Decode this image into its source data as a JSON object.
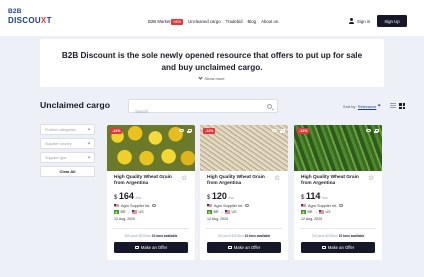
{
  "header": {
    "logo_top": "B2B",
    "logo_main": "DISCOU",
    "logo_x": "X",
    "logo_t": "T",
    "nav": [
      {
        "label": "B2B Market"
      },
      {
        "label": "Uncleaned cargo"
      },
      {
        "label": "Tradebid"
      },
      {
        "label": "Blog"
      },
      {
        "label": "About us"
      }
    ],
    "new_badge": "NEW",
    "signin_label": "Sign in",
    "signup_label": "Sign Up"
  },
  "hero": {
    "text": "B2B Discount is the sole newly opened resource that offers to put up for sale and buy unclaimed cargo.",
    "show_more": "Show more"
  },
  "toolbar": {
    "title": "Unclaimed cargo",
    "search_placeholder": "Search",
    "sort_label": "Sort by:",
    "sort_value": "Relevance"
  },
  "filters": {
    "items": [
      {
        "label": "Product categories"
      },
      {
        "label": "Supplier country"
      },
      {
        "label": "Supplier type"
      }
    ],
    "clear_label": "Clear All"
  },
  "cards": [
    {
      "discount": "-12%",
      "title": "High Quality Wheat Grain from Argentina",
      "currency": "$",
      "price": "164",
      "unit": "/ton",
      "supplier": "Agro Supplier Int.",
      "route_from": "BR",
      "route_to": "US",
      "date": "12 Aug, 2020",
      "old_price": "$16 price $200/ton",
      "tons": "10 tons available",
      "offer_label": "Make an Offer"
    },
    {
      "discount": "-12%",
      "title": "High Quality Wheat Grain from Argentina",
      "currency": "$",
      "price": "120",
      "unit": "/ton",
      "supplier": "Agro Supplier Int.",
      "route_from": "BR",
      "route_to": "US",
      "date": "12 Aug, 2020",
      "old_price": "Old price $200/ton",
      "tons": "10 tons available",
      "offer_label": "Make an Offer"
    },
    {
      "discount": "-12%",
      "title": "High Quality Wheat Grain from Argentina",
      "currency": "$",
      "price": "114",
      "unit": "/ton",
      "supplier": "Agro Supplier Int.",
      "route_from": "BR",
      "route_to": "US",
      "date": "12 Aug, 2020",
      "old_price": "Old price $200/ton",
      "tons": "10 tons available",
      "offer_label": "Make an Offer"
    }
  ]
}
